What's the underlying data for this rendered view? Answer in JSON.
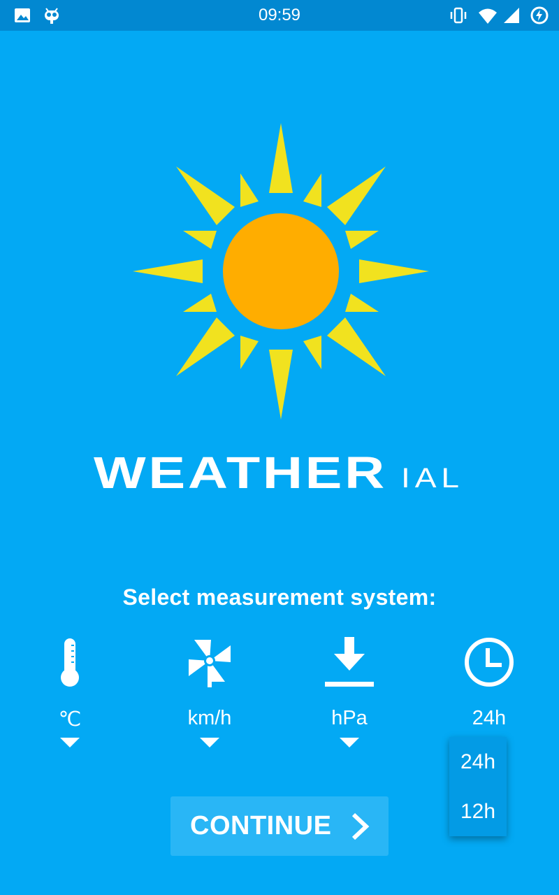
{
  "status_bar": {
    "time": "09:59",
    "left_icons": [
      "image-icon",
      "cyanogen-bot-icon"
    ],
    "right_icons": [
      "vibrate-icon",
      "wifi-icon",
      "cell-signal-icon",
      "battery-charging-icon"
    ]
  },
  "app": {
    "logo_icon": "sun-icon",
    "wordmark_bold": "WEATHER",
    "wordmark_light": "IAL"
  },
  "prompt": "Select measurement system:",
  "units": [
    {
      "icon": "thermometer-icon",
      "value": "℃"
    },
    {
      "icon": "pinwheel-wind-icon",
      "value": "km/h"
    },
    {
      "icon": "pressure-down-arrow-icon",
      "value": "hPa"
    },
    {
      "icon": "clock-icon",
      "value": "24h"
    }
  ],
  "dropdown": {
    "options": [
      "24h",
      "12h"
    ]
  },
  "continue_button": {
    "label": "CONTINUE",
    "icon": "chevron-right-icon"
  },
  "colors": {
    "background": "#03a9f4",
    "status_bar": "#0288d1",
    "sun_core": "#ffad00",
    "sun_rays": "#f1e21f",
    "button": "#29b6f6"
  }
}
